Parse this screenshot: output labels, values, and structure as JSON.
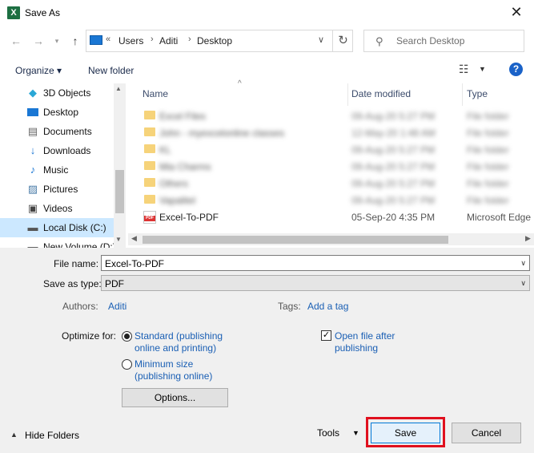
{
  "window": {
    "title": "Save As",
    "app_icon": "excel-icon",
    "app_icon_letter": "X",
    "close_glyph": "✕"
  },
  "address": {
    "more_glyph": "«",
    "crumbs": [
      "Users",
      "Aditi",
      "Desktop"
    ],
    "search_placeholder": "Search Desktop"
  },
  "toolbar": {
    "organize_label": "Organize ▾",
    "new_folder_label": "New folder",
    "help_glyph": "?"
  },
  "nav": {
    "items": [
      {
        "label": "3D Objects",
        "icon": "3d-objects-icon"
      },
      {
        "label": "Desktop",
        "icon": "desktop-icon"
      },
      {
        "label": "Documents",
        "icon": "documents-icon"
      },
      {
        "label": "Downloads",
        "icon": "downloads-icon"
      },
      {
        "label": "Music",
        "icon": "music-icon"
      },
      {
        "label": "Pictures",
        "icon": "pictures-icon"
      },
      {
        "label": "Videos",
        "icon": "videos-icon"
      },
      {
        "label": "Local Disk (C:)",
        "icon": "local-disk-icon",
        "selected": true
      },
      {
        "label": "New Volume (D:)",
        "icon": "drive-icon"
      }
    ]
  },
  "filelist": {
    "columns": {
      "name": "Name",
      "date": "Date modified",
      "type": "Type"
    },
    "rows": [
      {
        "name": "Excel Files",
        "date": "09-Aug-20 5:27 PM",
        "type": "File folder",
        "blurred": true
      },
      {
        "name": "John - myexcelonline classes",
        "date": "12-May-20 1:48 AM",
        "type": "File folder",
        "blurred": true
      },
      {
        "name": "KL",
        "date": "09-Aug-20 5:27 PM",
        "type": "File folder",
        "blurred": true
      },
      {
        "name": "Mia Charms",
        "date": "09-Aug-20 5:27 PM",
        "type": "File folder",
        "blurred": true
      },
      {
        "name": "Others",
        "date": "09-Aug-20 5:27 PM",
        "type": "File folder",
        "blurred": true
      },
      {
        "name": "Vapalitel",
        "date": "09-Aug-20 5:27 PM",
        "type": "File folder",
        "blurred": true
      },
      {
        "name": "Excel-To-PDF",
        "date": "05-Sep-20 4:35 PM",
        "type": "Microsoft Edge",
        "blurred": false,
        "icon": "pdf-file-icon",
        "icon_label": "PDF"
      }
    ]
  },
  "form": {
    "file_name_label": "File name:",
    "file_name_value": "Excel-To-PDF",
    "save_type_label": "Save as type:",
    "save_type_value": "PDF",
    "authors_label": "Authors:",
    "authors_value": "Aditi",
    "tags_label": "Tags:",
    "tags_value": "Add a tag",
    "optimize_label": "Optimize for:",
    "opt_standard_line1": "Standard (publishing",
    "opt_standard_line2": "online and printing)",
    "opt_min_line1": "Minimum size",
    "opt_min_line2": "(publishing online)",
    "open_after_line1": "Open file after",
    "open_after_line2": "publishing",
    "options_button": "Options...",
    "selected_optimize": "standard",
    "open_after_checked": true
  },
  "footer": {
    "hide_folders_label": "Hide Folders",
    "tools_label": "Tools",
    "save_label": "Save",
    "cancel_label": "Cancel"
  },
  "colors": {
    "accent": "#1a62c8",
    "highlight": "#e0101e",
    "selection": "#cce8ff"
  }
}
